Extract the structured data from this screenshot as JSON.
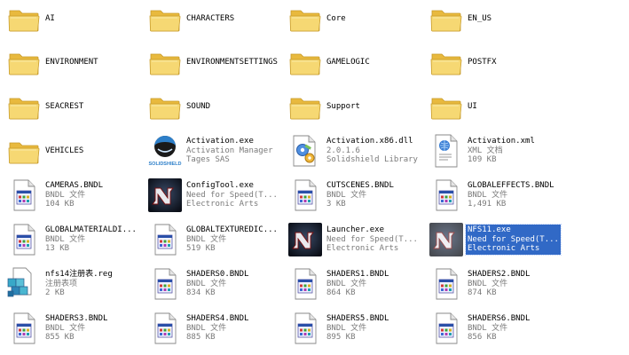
{
  "colors": {
    "folder": "#f5d26a",
    "selection": "#3169c6"
  },
  "items": [
    {
      "type": "folder",
      "name": "AI",
      "icon": "folder-icon"
    },
    {
      "type": "folder",
      "name": "CHARACTERS",
      "icon": "folder-icon"
    },
    {
      "type": "folder",
      "name": "Core",
      "icon": "folder-icon"
    },
    {
      "type": "folder",
      "name": "EN_US",
      "icon": "folder-icon"
    },
    {
      "type": "folder",
      "name": "ENVIRONMENT",
      "icon": "folder-icon"
    },
    {
      "type": "folder",
      "name": "ENVIRONMENTSETTINGS",
      "icon": "folder-icon"
    },
    {
      "type": "folder",
      "name": "GAMELOGIC",
      "icon": "folder-icon"
    },
    {
      "type": "folder",
      "name": "POSTFX",
      "icon": "folder-icon"
    },
    {
      "type": "folder",
      "name": "SEACREST",
      "icon": "folder-icon"
    },
    {
      "type": "folder",
      "name": "SOUND",
      "icon": "folder-icon"
    },
    {
      "type": "folder",
      "name": "Support",
      "icon": "folder-icon"
    },
    {
      "type": "folder",
      "name": "UI",
      "icon": "folder-icon"
    },
    {
      "type": "folder",
      "name": "VEHICLES",
      "icon": "folder-icon"
    },
    {
      "type": "file",
      "name": "Activation.exe",
      "line2": "Activation Manager",
      "line3": "Tages SAS",
      "icon": "solidshield-icon",
      "icon_caption": "SOLIDSHIELD"
    },
    {
      "type": "file",
      "name": "Activation.x86.dll",
      "line2": "2.0.1.6",
      "line3": "Solidshield Library",
      "icon": "dll-gear-icon"
    },
    {
      "type": "file",
      "name": "Activation.xml",
      "line2": "XML 文档",
      "line3": "109 KB",
      "icon": "xml-file-icon"
    },
    {
      "type": "file",
      "name": "CAMERAS.BNDL",
      "line2": "BNDL 文件",
      "line3": "104 KB",
      "icon": "generic-file-icon"
    },
    {
      "type": "file",
      "name": "ConfigTool.exe",
      "line2": "Need for Speed(T...",
      "line3": "Electronic Arts",
      "icon": "nfs-app-icon"
    },
    {
      "type": "file",
      "name": "CUTSCENES.BNDL",
      "line2": "BNDL 文件",
      "line3": "3 KB",
      "icon": "generic-file-icon"
    },
    {
      "type": "file",
      "name": "GLOBALEFFECTS.BNDL",
      "line2": "BNDL 文件",
      "line3": "1,491 KB",
      "icon": "generic-file-icon"
    },
    {
      "type": "file",
      "name": "GLOBALMATERIALDI...",
      "line2": "BNDL 文件",
      "line3": "13 KB",
      "icon": "generic-file-icon"
    },
    {
      "type": "file",
      "name": "GLOBALTEXTUREDIC...",
      "line2": "BNDL 文件",
      "line3": "519 KB",
      "icon": "generic-file-icon"
    },
    {
      "type": "file",
      "name": "Launcher.exe",
      "line2": "Need for Speed(T...",
      "line3": "Electronic Arts",
      "icon": "nfs-app-icon"
    },
    {
      "type": "file",
      "name": "NFS11.exe",
      "line2": "Need for Speed(T...",
      "line3": "Electronic Arts",
      "icon": "nfs-app-icon",
      "selected": true
    },
    {
      "type": "file",
      "name": "nfs14注册表.reg",
      "line2": "注册表项",
      "line3": "2 KB",
      "icon": "registry-file-icon"
    },
    {
      "type": "file",
      "name": "SHADERS0.BNDL",
      "line2": "BNDL 文件",
      "line3": "834 KB",
      "icon": "generic-file-icon"
    },
    {
      "type": "file",
      "name": "SHADERS1.BNDL",
      "line2": "BNDL 文件",
      "line3": "864 KB",
      "icon": "generic-file-icon"
    },
    {
      "type": "file",
      "name": "SHADERS2.BNDL",
      "line2": "BNDL 文件",
      "line3": "874 KB",
      "icon": "generic-file-icon"
    },
    {
      "type": "file",
      "name": "SHADERS3.BNDL",
      "line2": "BNDL 文件",
      "line3": "855 KB",
      "icon": "generic-file-icon"
    },
    {
      "type": "file",
      "name": "SHADERS4.BNDL",
      "line2": "BNDL 文件",
      "line3": "885 KB",
      "icon": "generic-file-icon"
    },
    {
      "type": "file",
      "name": "SHADERS5.BNDL",
      "line2": "BNDL 文件",
      "line3": "895 KB",
      "icon": "generic-file-icon"
    },
    {
      "type": "file",
      "name": "SHADERS6.BNDL",
      "line2": "BNDL 文件",
      "line3": "856 KB",
      "icon": "generic-file-icon"
    }
  ]
}
